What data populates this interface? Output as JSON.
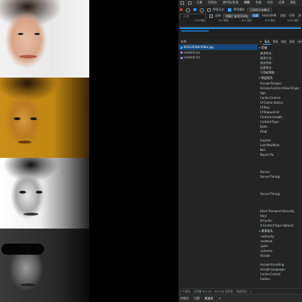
{
  "devtools": {
    "top_tabs": [
      "元素",
      "控制台",
      "源代码/来源",
      "网络",
      "性能",
      "内存",
      "应用",
      "隐私"
    ],
    "active_top_tab": "网络",
    "toolbar1": {
      "preserve_log": "保留日志",
      "disable_cache": "停用缓存",
      "throttle": "已停用节流模式"
    },
    "toolbar2": {
      "filter_placeholder": "过滤",
      "invert": "反转",
      "hide_extensions": "隐藏扩展程序网址",
      "types": [
        "全部",
        "Fetch/XHR",
        "文档",
        "CSS",
        "JS",
        "字体"
      ],
      "active_type": "全部"
    },
    "timeline_ticks": [
      "200 毫秒",
      "400 毫秒",
      "600 毫秒",
      "800 毫秒",
      "1000 毫秒"
    ],
    "request_list": {
      "header": "名称",
      "rows": [
        {
          "name": "6501353bfc938a.jpg",
          "selected": true,
          "icon_color": "#4aa3ff"
        },
        {
          "name": "content.css",
          "selected": false,
          "icon_color": "#b37feb"
        },
        {
          "name": "content.css",
          "selected": false,
          "icon_color": "#b37feb"
        }
      ]
    },
    "headers_panel": {
      "tabs": [
        "×",
        "标头",
        "预览",
        "响应",
        "发起",
        "计时"
      ],
      "active_tab": "标头",
      "general": {
        "title": "常规",
        "keys": [
          "请求网址:",
          "请求方法:",
          "状态代码:",
          "远程地址:",
          "引用者策略:"
        ]
      },
      "response": {
        "title": "响应标头",
        "keys": [
          "Accept-Ranges:",
          "Access-Control-Allow-Origin:",
          "Age:",
          "Cache-Control:",
          "Cf-Cache-Status:",
          "Cf-Ray:",
          "Cf-Request-Id:",
          "Content-Length:",
          "Content-Type:",
          "Date:",
          "Etag:",
          "",
          "Expires:",
          "Last-Modified:",
          "Nel:",
          "Report-To:",
          "",
          "",
          "",
          "Server:",
          "Server-Timing:",
          "",
          "",
          "",
          "Server-Timing:",
          "",
          "",
          "",
          "Strict-Transport-Security:",
          "Vary:",
          "X-Cache:",
          "X-Content-Type-Options:"
        ]
      },
      "request": {
        "title": "请求标头",
        "keys": [
          ":authority:",
          ":method:",
          ":path:",
          ":scheme:",
          "Accept:",
          "",
          "Accept-Encoding:",
          "Accept-Language:",
          "Cache-Control:",
          "Cookie:"
        ]
      }
    },
    "status": [
      "3 个请求",
      "已传输 854 kB",
      "853 kB 项资源",
      "完成用时：1..."
    ],
    "drawer_tabs": [
      "控制台",
      "问题",
      "新变化",
      "×"
    ],
    "drawer_active": "新变化"
  }
}
